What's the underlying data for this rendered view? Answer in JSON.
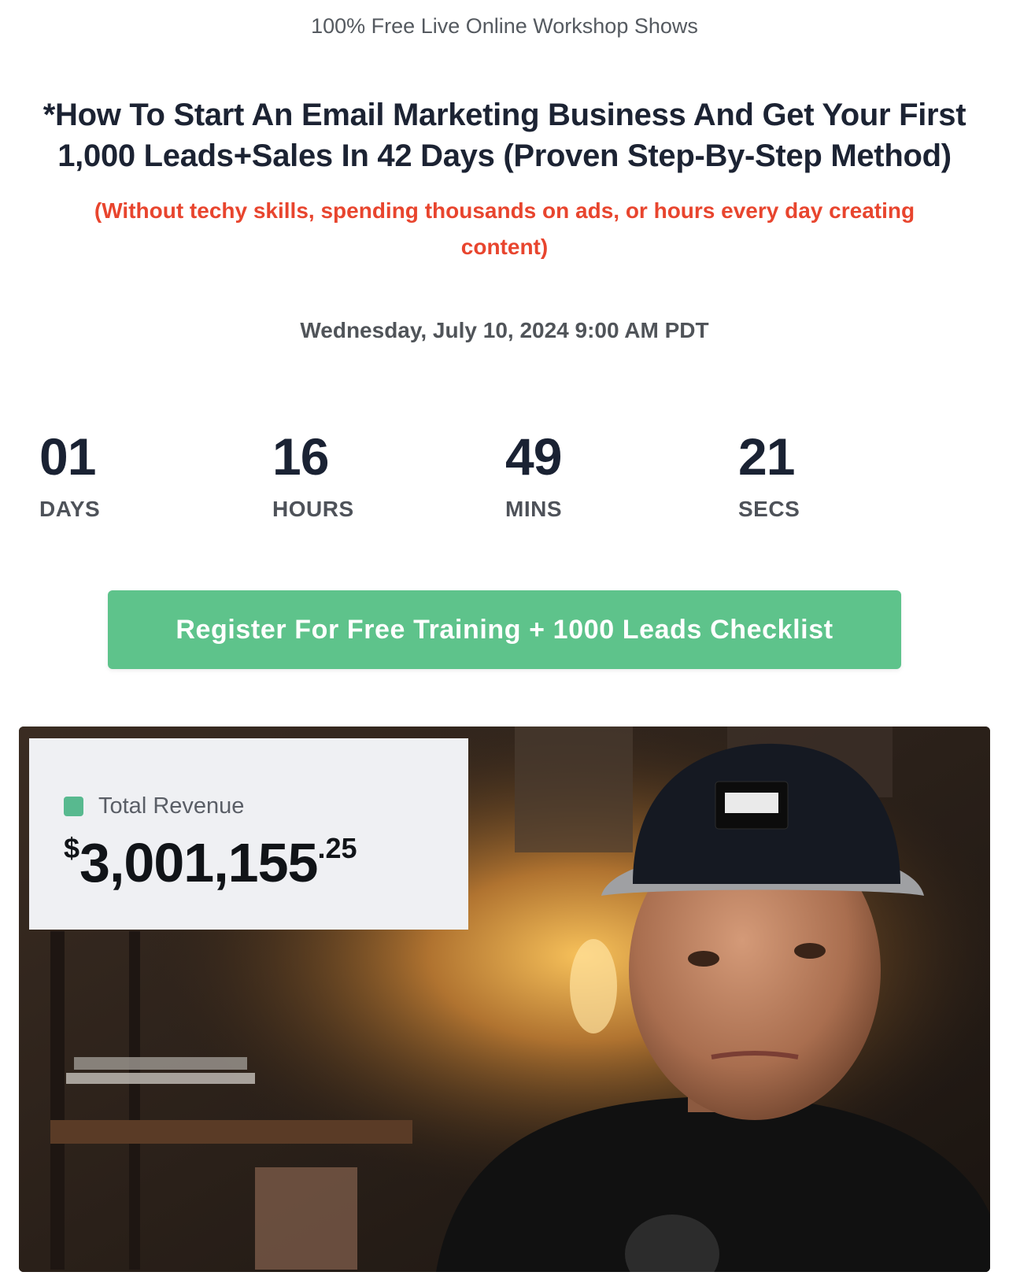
{
  "kicker": "100% Free Live Online Workshop Shows",
  "headline": "*How To Start An Email Marketing Business And Get Your First 1,000 Leads+Sales In 42 Days (Proven Step-By-Step Method)",
  "subheadline": "(Without techy skills, spending thousands on ads, or hours every day creating content)",
  "event_datetime": "Wednesday, July 10, 2024 9:00 AM PDT",
  "countdown": {
    "days": {
      "value": "01",
      "label": "DAYS"
    },
    "hours": {
      "value": "16",
      "label": "HOURS"
    },
    "mins": {
      "value": "49",
      "label": "MINS"
    },
    "secs": {
      "value": "21",
      "label": "SECS"
    }
  },
  "cta": {
    "label": "Register For Free Training + 1000 Leads Checklist",
    "color": "#5ec38b"
  },
  "hero": {
    "revenue_label": "Total Revenue",
    "revenue_currency": "$",
    "revenue_whole": "3,001,155",
    "revenue_cents": ".25",
    "revenue_dot_color": "#58b98f"
  },
  "colors": {
    "headline": "#1c2333",
    "subheadline": "#e8452e",
    "muted": "#505459"
  }
}
